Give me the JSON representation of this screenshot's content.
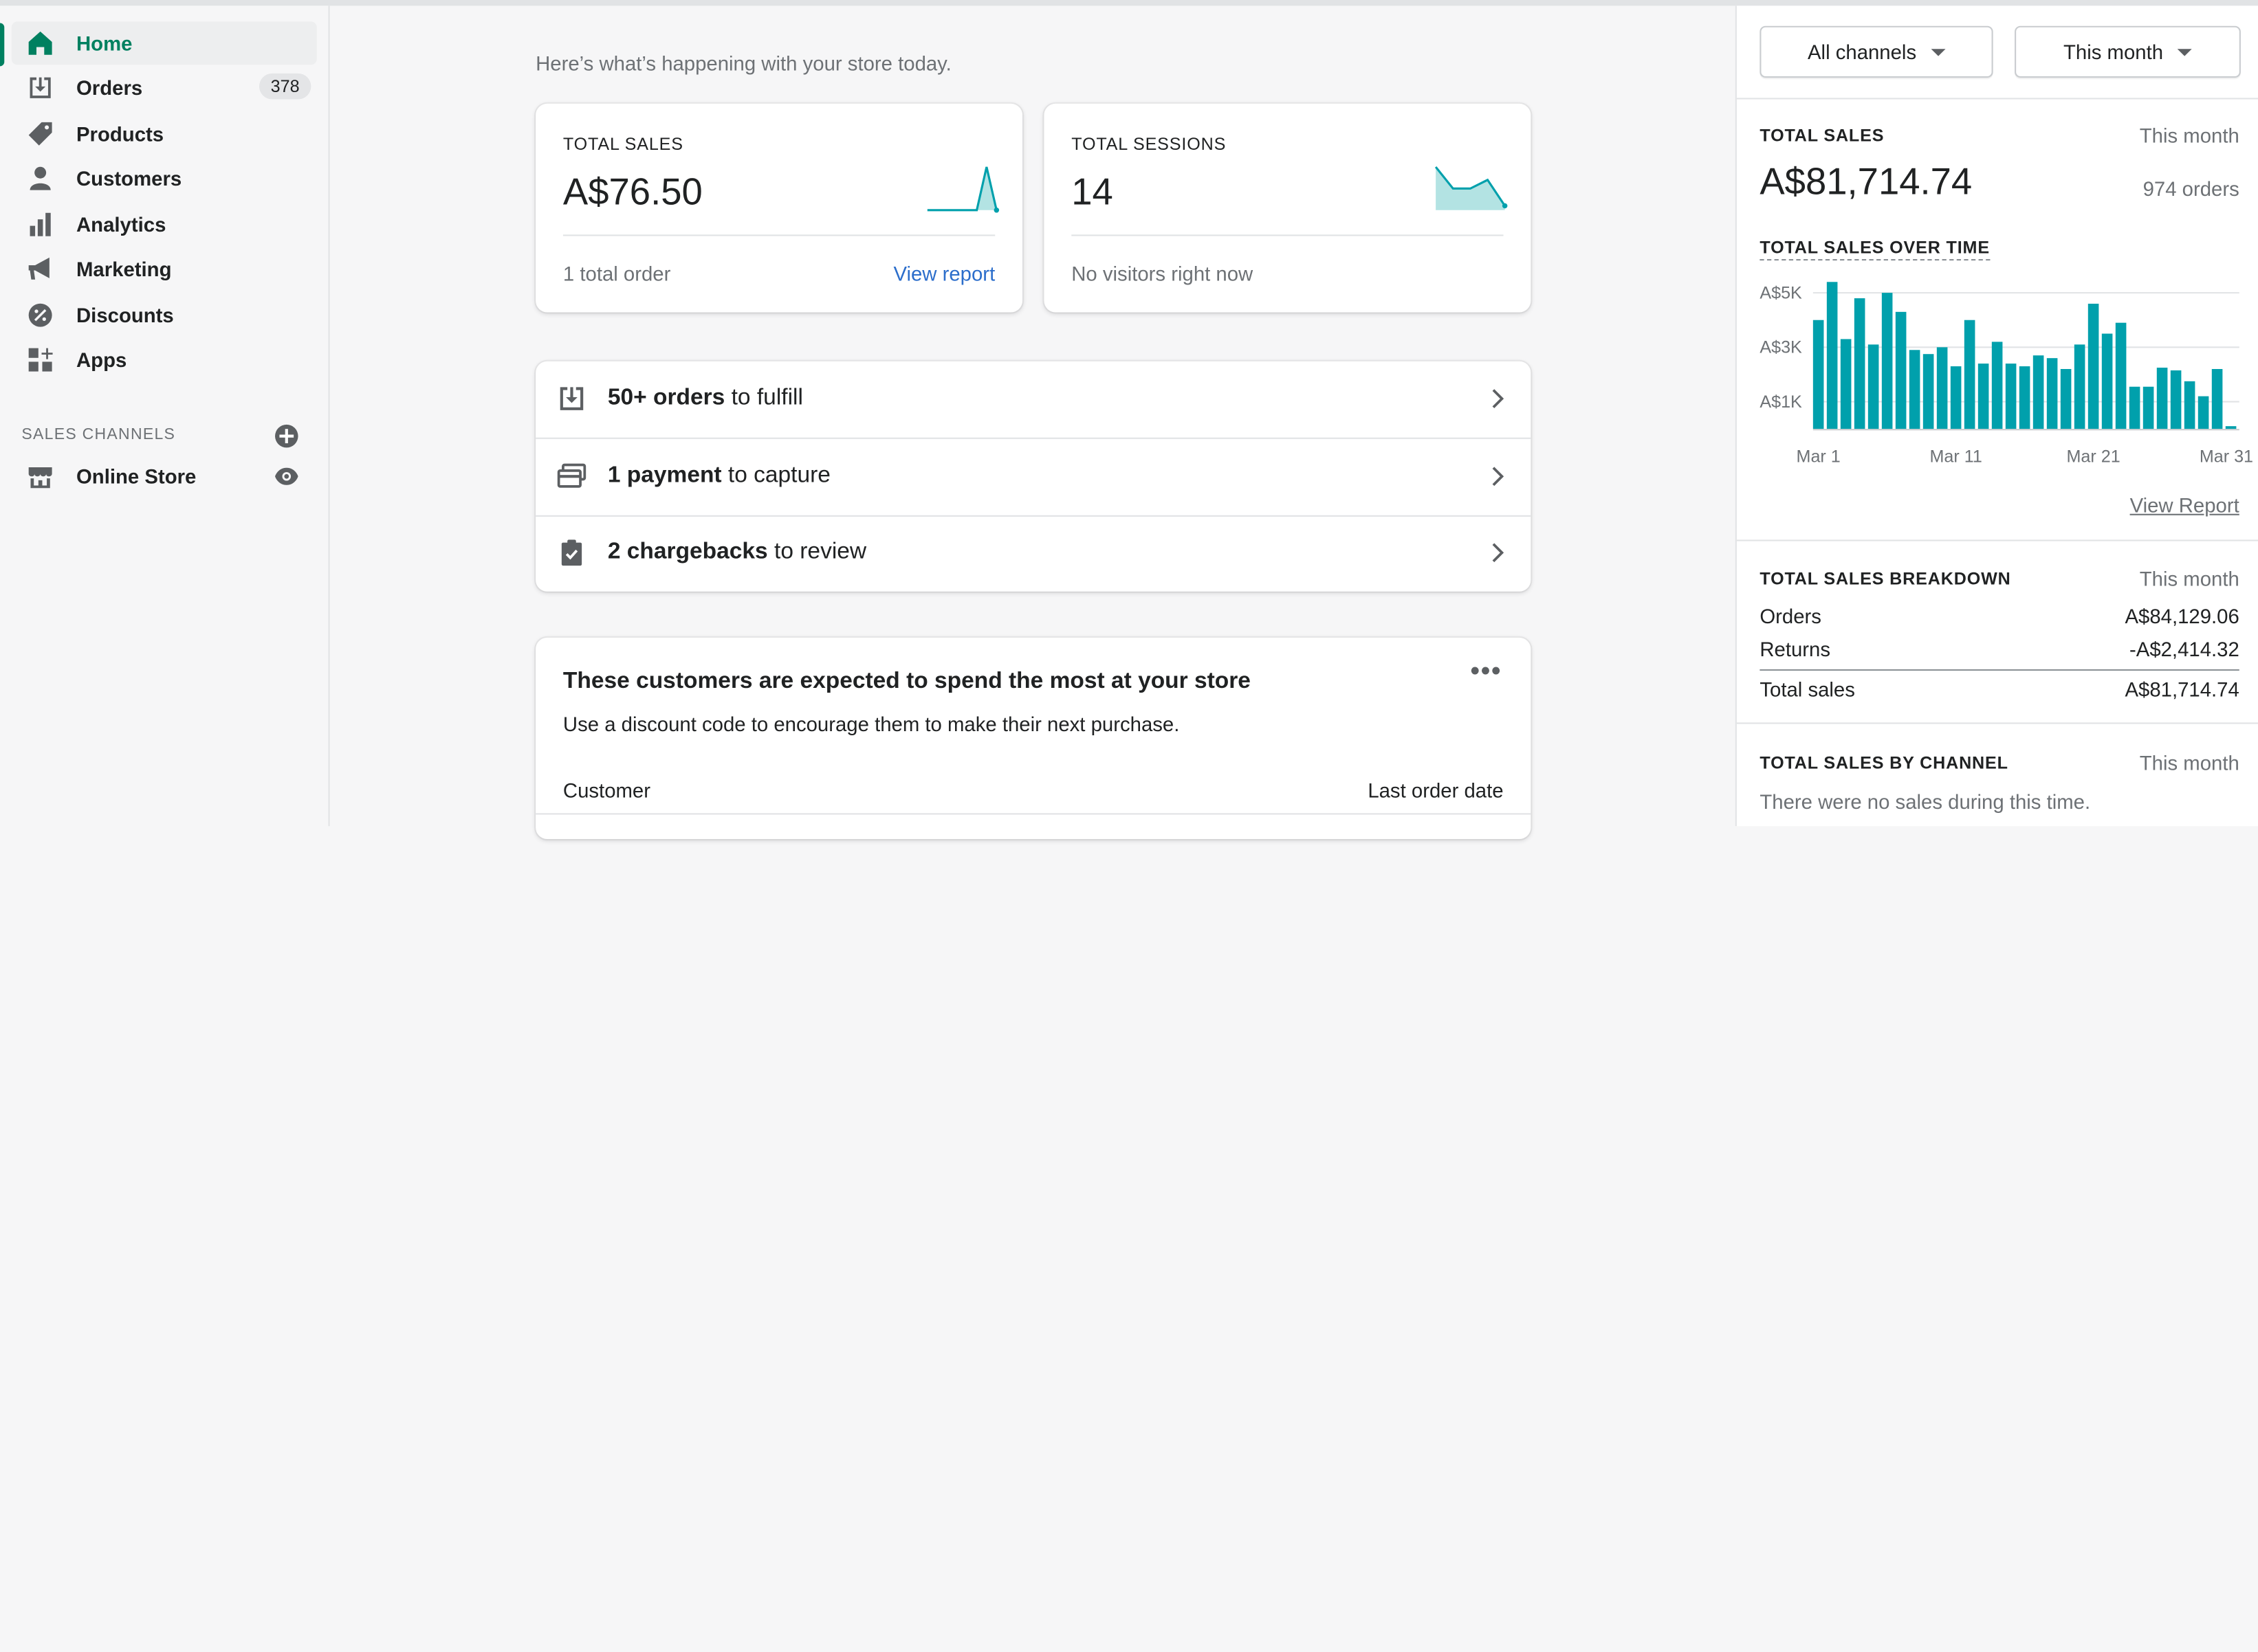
{
  "sidebar": {
    "items": [
      {
        "label": "Home",
        "icon": "home-icon",
        "active": true
      },
      {
        "label": "Orders",
        "icon": "orders-icon",
        "badge": "378"
      },
      {
        "label": "Products",
        "icon": "tag-icon"
      },
      {
        "label": "Customers",
        "icon": "person-icon"
      },
      {
        "label": "Analytics",
        "icon": "bar-chart-icon"
      },
      {
        "label": "Marketing",
        "icon": "megaphone-icon"
      },
      {
        "label": "Discounts",
        "icon": "discount-icon"
      },
      {
        "label": "Apps",
        "icon": "apps-icon"
      }
    ],
    "sales_channels_title": "SALES CHANNELS",
    "online_store_label": "Online Store"
  },
  "main": {
    "intro": "Here’s what’s happening with your store today.",
    "total_sales": {
      "title": "TOTAL SALES",
      "value": "A$76.50",
      "footer": "1 total order",
      "link": "View report"
    },
    "total_sessions": {
      "title": "TOTAL SESSIONS",
      "value": "14",
      "footer": "No visitors right now"
    },
    "todos": [
      {
        "bold": "50+ orders",
        "rest": " to fulfill",
        "icon": "orders-icon"
      },
      {
        "bold": "1 payment",
        "rest": " to capture",
        "icon": "payment-icon"
      },
      {
        "bold": "2 chargebacks",
        "rest": " to review",
        "icon": "clipboard-icon"
      }
    ],
    "customers": {
      "title": "These customers are expected to spend the most at your store",
      "subtitle": "Use a discount code to encourage them to make their next purchase.",
      "col_customer": "Customer",
      "col_last_order": "Last order date"
    }
  },
  "panel": {
    "channels_select": "All channels",
    "period_select": "This month",
    "total_sales_label": "TOTAL SALES",
    "total_sales_period": "This month",
    "total_sales_value": "A$81,714.74",
    "orders_count": "974 orders",
    "over_time_label": "TOTAL SALES OVER TIME",
    "view_report": "View Report",
    "breakdown_label": "TOTAL SALES BREAKDOWN",
    "breakdown_period": "This month",
    "breakdown": [
      {
        "label": "Orders",
        "value": "A$84,129.06"
      },
      {
        "label": "Returns",
        "value": "-A$2,414.32"
      },
      {
        "label": "Total sales",
        "value": "A$81,714.74"
      }
    ],
    "by_channel_label": "TOTAL SALES BY CHANNEL",
    "by_channel_period": "This month",
    "by_channel_empty": "There were no sales during this time."
  },
  "colors": {
    "accent": "#008060",
    "chart": "#00a0ac",
    "link": "#2c6ecb"
  },
  "chart_data": {
    "type": "bar",
    "title": "TOTAL SALES OVER TIME",
    "x_tick_labels": [
      "Mar 1",
      "Mar 11",
      "Mar 21",
      "Mar 31"
    ],
    "y_tick_labels": [
      "A$5K",
      "A$3K",
      "A$1K"
    ],
    "categories": [
      "Mar 1",
      "Mar 2",
      "Mar 3",
      "Mar 4",
      "Mar 5",
      "Mar 6",
      "Mar 7",
      "Mar 8",
      "Mar 9",
      "Mar 10",
      "Mar 11",
      "Mar 12",
      "Mar 13",
      "Mar 14",
      "Mar 15",
      "Mar 16",
      "Mar 17",
      "Mar 18",
      "Mar 19",
      "Mar 20",
      "Mar 21",
      "Mar 22",
      "Mar 23",
      "Mar 24",
      "Mar 25",
      "Mar 26",
      "Mar 27",
      "Mar 28",
      "Mar 29",
      "Mar 30",
      "Mar 31"
    ],
    "values": [
      4000,
      5400,
      3300,
      4800,
      3100,
      5000,
      4300,
      2900,
      2750,
      3000,
      2300,
      4000,
      2400,
      3200,
      2400,
      2300,
      2700,
      2600,
      2200,
      3100,
      4600,
      3500,
      3900,
      1550,
      1550,
      2250,
      2150,
      1750,
      1200,
      2200,
      100
    ],
    "ylim": [
      0,
      5500
    ],
    "grid": true
  },
  "sparklines": {
    "total_sales": [
      0,
      0,
      0,
      0,
      0,
      0,
      2.2,
      0
    ],
    "total_sessions": [
      2,
      1,
      1,
      1.4,
      0.2
    ]
  }
}
